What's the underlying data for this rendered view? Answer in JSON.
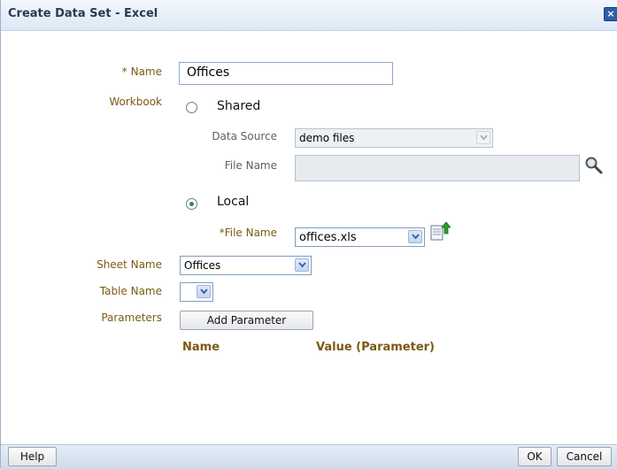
{
  "window": {
    "title": "Create Data Set - Excel",
    "close_glyph": "×"
  },
  "form": {
    "name_label": "* Name",
    "name_value": "Offices",
    "workbook_label": "Workbook",
    "shared_label": "Shared",
    "data_source_label": "Data Source",
    "data_source_value": "demo files",
    "file_name_label": "File Name",
    "local_label": "Local",
    "local_file_name_label": "*File Name",
    "local_file_value": "offices.xls",
    "sheet_name_label": "Sheet Name",
    "sheet_name_value": "Offices",
    "table_name_label": "Table Name",
    "table_name_value": "",
    "parameters_label": "Parameters",
    "add_parameter_label": "Add Parameter",
    "table_columns": [
      "Name",
      "Value (Parameter)"
    ],
    "workbook_selected": "Local"
  },
  "footer": {
    "help_label": "Help",
    "ok_label": "OK",
    "cancel_label": "Cancel"
  }
}
